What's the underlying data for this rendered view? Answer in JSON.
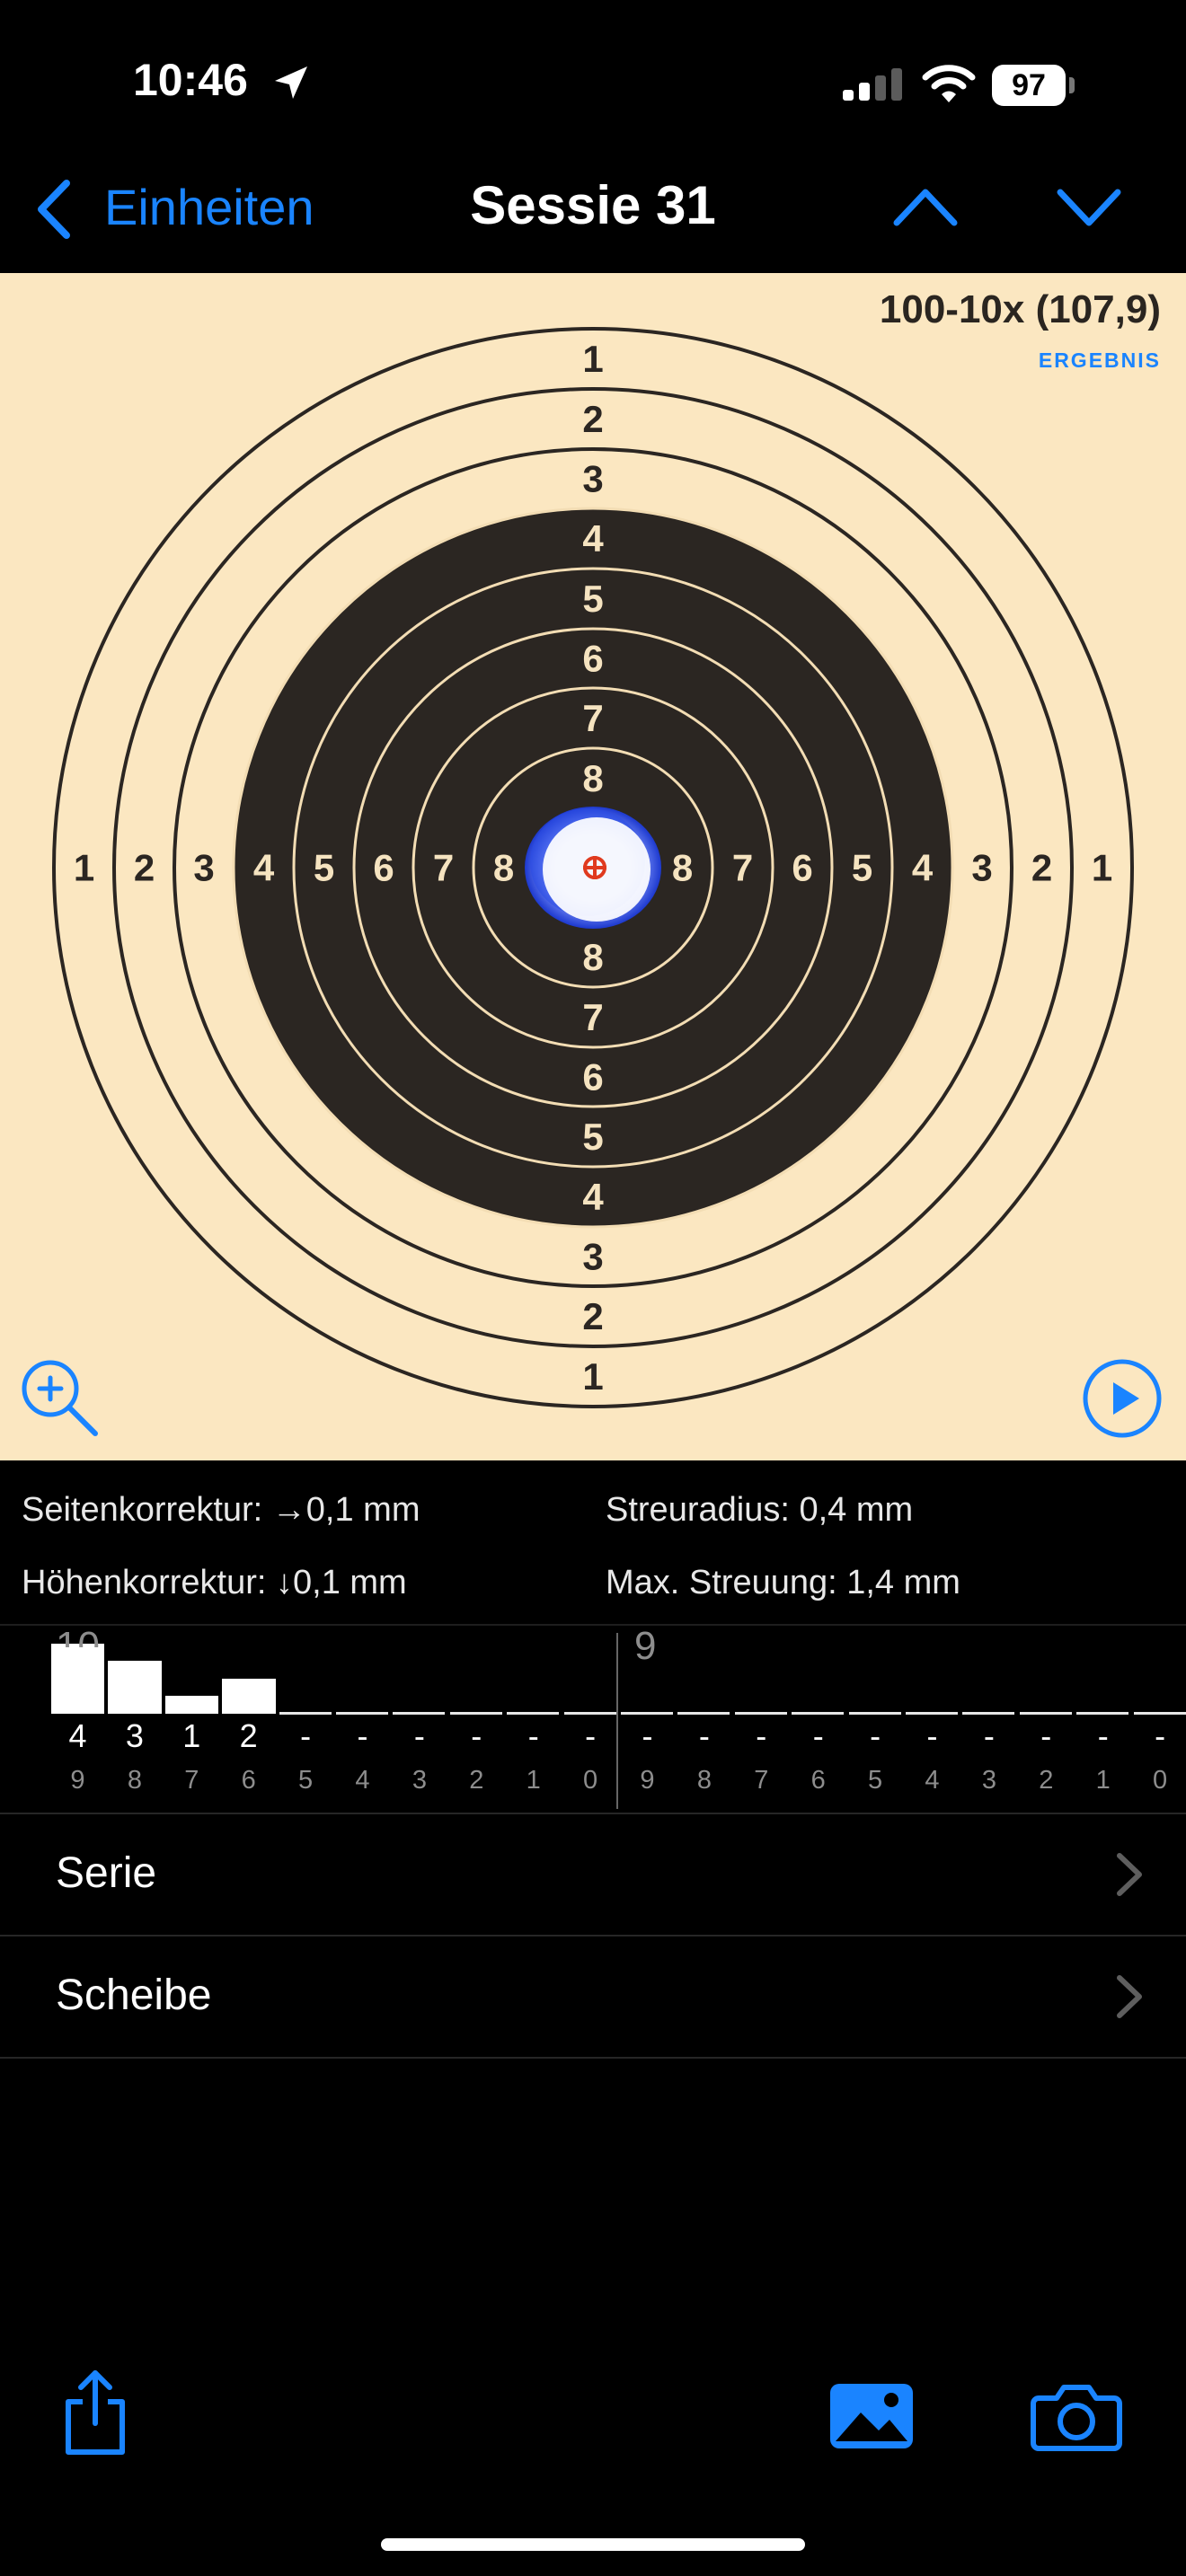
{
  "status_bar": {
    "time": "10:46",
    "battery": "97"
  },
  "nav": {
    "back_label": "Einheiten",
    "title": "Sessie 31"
  },
  "target": {
    "score": "100-10x (107,9)",
    "score_label": "ERGEBNIS",
    "ring_labels": [
      "1",
      "2",
      "3",
      "4",
      "5",
      "6",
      "7",
      "8"
    ]
  },
  "stats": {
    "side_correction": "Seitenkorrektur: →0,1 mm",
    "height_correction": "Höhenkorrektur: ↓0,1 mm",
    "spread_radius": "Streuradius: 0,4 mm",
    "max_spread": "Max. Streuung: 1,4 mm"
  },
  "histogram": {
    "series": [
      {
        "label": "10",
        "rings": [
          "9",
          "8",
          "7",
          "6",
          "5",
          "4",
          "3",
          "2",
          "1",
          "0"
        ],
        "counts": [
          "4",
          "3",
          "1",
          "2",
          "-",
          "-",
          "-",
          "-",
          "-",
          "-"
        ],
        "values": [
          4,
          3,
          1,
          2,
          0,
          0,
          0,
          0,
          0,
          0
        ]
      },
      {
        "label": "9",
        "rings": [
          "9",
          "8",
          "7",
          "6",
          "5",
          "4",
          "3",
          "2",
          "1",
          "0"
        ],
        "counts": [
          "-",
          "-",
          "-",
          "-",
          "-",
          "-",
          "-",
          "-",
          "-",
          "-"
        ],
        "values": [
          0,
          0,
          0,
          0,
          0,
          0,
          0,
          0,
          0,
          0
        ]
      }
    ]
  },
  "list": {
    "serie": "Serie",
    "scheibe": "Scheibe"
  },
  "colors": {
    "accent": "#1a84ff",
    "target_bg": "#fbe7c1",
    "target_black": "#2b2622",
    "center_mark": "#e03a1e"
  },
  "icons": {
    "back": "chevron-left-icon",
    "up": "chevron-up-icon",
    "down": "chevron-down-icon",
    "zoom": "zoom-in-icon",
    "play": "play-icon",
    "share": "share-icon",
    "photo": "photo-icon",
    "camera": "camera-icon"
  }
}
